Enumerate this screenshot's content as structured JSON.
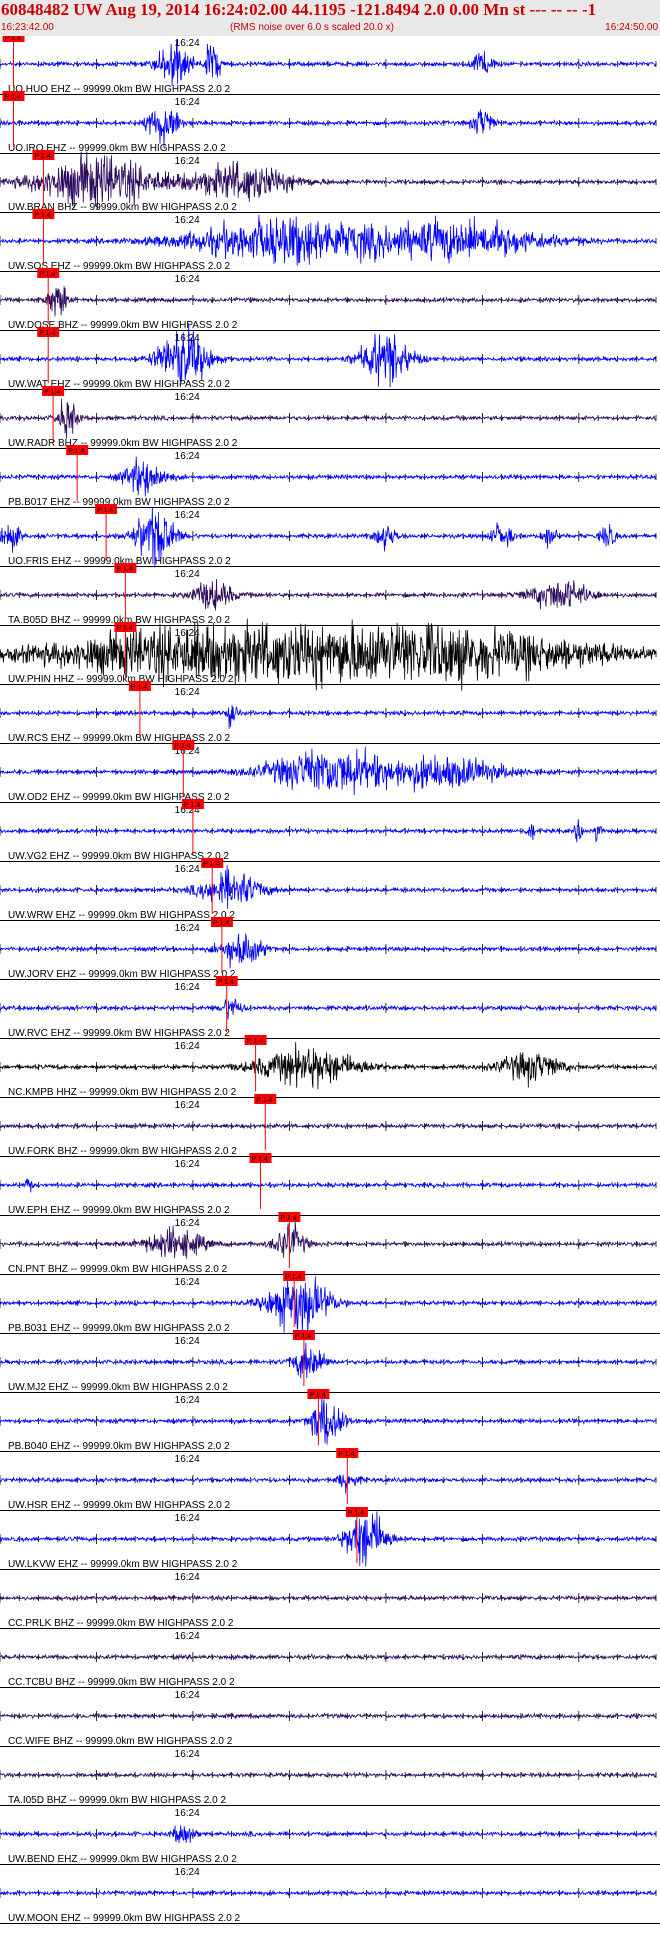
{
  "header": {
    "title": "60848482 UW Aug 19, 2014 16:24:02.00   44.1195 -121.8494  2.0 0.00 Mn st --- -- --   -1",
    "start_time": "16:23:42.00",
    "noise_note": "(RMS noise over 6.0 s scaled 20.0 x)",
    "end_time": "16:24:50.00"
  },
  "chart_data": {
    "type": "line",
    "xlim": [
      "16:23:42.00",
      "16:24:50.00"
    ],
    "minute_mark": "16:24",
    "phase_label": "P 1.4",
    "colors": {
      "blue": "#0000ff",
      "black": "#000000",
      "purple": "#2a0a5e",
      "pick": "#ff0000"
    },
    "series": [
      {
        "name": "UO.HUO EHZ -- 99999.0km BW  HIGHPASS  2.0  2",
        "color": "blue",
        "pick_s": 1.4,
        "events": [
          [
            18,
            3.5,
            1.5
          ],
          [
            22,
            3,
            0.8
          ],
          [
            50,
            2,
            1
          ]
        ],
        "bursts": [
          [
            80,
            1,
            0.8
          ],
          [
            95,
            1.5,
            1
          ]
        ]
      },
      {
        "name": "UO.IRO EHZ -- 99999.0km BW  HIGHPASS  2.0  2",
        "color": "blue",
        "pick_s": 1.4,
        "events": [
          [
            17,
            3,
            1.5
          ],
          [
            50,
            2,
            1
          ]
        ],
        "bursts": []
      },
      {
        "name": "UW.BRAN BHZ -- 99999.0km BW  HIGHPASS  2.0  2",
        "color": "purple",
        "pick_s": 4.5,
        "events": [
          [
            10,
            3.5,
            6
          ],
          [
            25,
            2.5,
            5
          ]
        ],
        "bursts": []
      },
      {
        "name": "UW.SOS EHZ -- 99999.0km BW  HIGHPASS  2.0  2",
        "color": "blue",
        "pick_s": 4.5,
        "events": [
          [
            30,
            3,
            10
          ],
          [
            48,
            2.5,
            8
          ]
        ],
        "bursts": []
      },
      {
        "name": "UW.DOSE BHZ -- 99999.0km BW  HIGHPASS  2.0  2",
        "color": "purple",
        "pick_s": 5.0,
        "events": [
          [
            6,
            2.5,
            1
          ]
        ],
        "bursts": []
      },
      {
        "name": "UW.WAT EHZ -- 99999.0km BW  HIGHPASS  2.0  2",
        "color": "blue",
        "pick_s": 5.0,
        "events": [
          [
            19,
            4,
            2.5
          ],
          [
            40,
            3.5,
            2.5
          ]
        ],
        "bursts": []
      },
      {
        "name": "UW.RADR BHZ -- 99999.0km BW  HIGHPASS  2.0  2",
        "color": "purple",
        "pick_s": 5.5,
        "events": [
          [
            7,
            2.5,
            1
          ]
        ],
        "bursts": []
      },
      {
        "name": "PB.B017 EHZ -- 99999.0km BW  HIGHPASS  2.0  2",
        "color": "blue",
        "pick_s": 8.0,
        "events": [
          [
            15,
            2.5,
            2
          ]
        ],
        "bursts": []
      },
      {
        "name": "UO.FRIS EHZ -- 99999.0km BW  HIGHPASS  2.0  2",
        "color": "blue",
        "pick_s": 11.0,
        "events": [
          [
            16,
            4,
            2
          ],
          [
            1,
            2,
            1
          ]
        ],
        "bursts": [
          [
            40,
            2,
            1.5
          ],
          [
            52,
            2,
            1.5
          ],
          [
            57,
            2,
            1
          ],
          [
            63,
            2,
            1
          ]
        ]
      },
      {
        "name": "TA.B05D BHZ -- 99999.0km BW  HIGHPASS  2.0  2",
        "color": "purple",
        "pick_s": 13.0,
        "events": [
          [
            22,
            2,
            2
          ],
          [
            58,
            2,
            3
          ]
        ],
        "bursts": []
      },
      {
        "name": "UW.PHIN HHZ -- 99999.0km BW  HIGHPASS  2.0  2",
        "color": "black",
        "pick_s": 13.0,
        "events": [
          [
            43,
            4,
            18
          ],
          [
            18,
            3,
            14
          ]
        ],
        "bursts": []
      },
      {
        "name": "UW.RCS EHZ -- 99999.0km BW  HIGHPASS  2.0  2",
        "color": "blue",
        "pick_s": 14.5,
        "events": [
          [
            24,
            2.5,
            0.5
          ]
        ],
        "bursts": []
      },
      {
        "name": "UW.OD2 EHZ -- 99999.0km BW  HIGHPASS  2.0  2",
        "color": "blue",
        "pick_s": 19.0,
        "events": [
          [
            34,
            3,
            6
          ],
          [
            46,
            2,
            6
          ]
        ],
        "bursts": []
      },
      {
        "name": "UW.VG2 EHZ -- 99999.0km BW  HIGHPASS  2.0  2",
        "color": "blue",
        "pick_s": 20.0,
        "events": [],
        "bursts": [
          [
            55,
            2,
            0.5
          ],
          [
            60,
            2,
            0.5
          ],
          [
            62,
            2,
            0.5
          ]
        ]
      },
      {
        "name": "UW.WRW EHZ -- 99999.0km BW  HIGHPASS  2.0  2",
        "color": "blue",
        "pick_s": 22.0,
        "events": [
          [
            24,
            2.5,
            3
          ]
        ],
        "bursts": []
      },
      {
        "name": "UW.JORV EHZ -- 99999.0km BW  HIGHPASS  2.0  2",
        "color": "blue",
        "pick_s": 23.0,
        "events": [
          [
            25,
            2.5,
            2
          ]
        ],
        "bursts": []
      },
      {
        "name": "UW.RVC EHZ -- 99999.0km BW  HIGHPASS  2.0  2",
        "color": "blue",
        "pick_s": 23.5,
        "events": [
          [
            24,
            1.5,
            1
          ]
        ],
        "bursts": []
      },
      {
        "name": "NC.KMPB HHZ -- 99999.0km BW  HIGHPASS  2.0  2",
        "color": "black",
        "pick_s": 26.5,
        "events": [
          [
            32,
            2.5,
            5
          ],
          [
            55,
            2,
            3
          ]
        ],
        "bursts": []
      },
      {
        "name": "UW.FORK BHZ -- 99999.0km BW  HIGHPASS  2.0  2",
        "color": "purple",
        "pick_s": 27.5,
        "events": [],
        "bursts": []
      },
      {
        "name": "UW.EPH EHZ -- 99999.0km BW  HIGHPASS  2.0  2",
        "color": "blue",
        "pick_s": 27.0,
        "events": [
          [
            3,
            1.5,
            0.3
          ]
        ],
        "bursts": []
      },
      {
        "name": "CN.PNT BHZ -- 99999.0km BW  HIGHPASS  2.0  2",
        "color": "purple",
        "pick_s": 30.0,
        "events": [
          [
            30,
            2.5,
            1.5
          ],
          [
            18,
            2,
            3
          ]
        ],
        "bursts": []
      },
      {
        "name": "PB.B031 EHZ -- 99999.0km BW  HIGHPASS  2.0  2",
        "color": "blue",
        "pick_s": 30.5,
        "events": [
          [
            31,
            4,
            3
          ]
        ],
        "bursts": []
      },
      {
        "name": "UW.MJ2 EHZ -- 99999.0km BW  HIGHPASS  2.0  2",
        "color": "blue",
        "pick_s": 31.5,
        "events": [
          [
            32,
            2.5,
            1.5
          ]
        ],
        "bursts": []
      },
      {
        "name": "PB.B040 EHZ -- 99999.0km BW  HIGHPASS  2.0  2",
        "color": "blue",
        "pick_s": 33.0,
        "events": [
          [
            34,
            4,
            1.5
          ]
        ],
        "bursts": []
      },
      {
        "name": "UW.HSR EHZ -- 99999.0km BW  HIGHPASS  2.0  2",
        "color": "blue",
        "pick_s": 36.0,
        "events": [
          [
            36,
            1.5,
            1
          ]
        ],
        "bursts": []
      },
      {
        "name": "UW.LKVW EHZ -- 99999.0km BW  HIGHPASS  2.0  2",
        "color": "blue",
        "pick_s": 37.0,
        "events": [
          [
            38,
            4,
            2
          ]
        ],
        "bursts": []
      },
      {
        "name": "CC.PRLK BHZ -- 99999.0km BW  HIGHPASS  2.0  2",
        "color": "purple",
        "pick_s": null,
        "events": [],
        "bursts": []
      },
      {
        "name": "CC.TCBU BHZ -- 99999.0km BW  HIGHPASS  2.0  2",
        "color": "purple",
        "pick_s": null,
        "events": [],
        "bursts": []
      },
      {
        "name": "CC.WIFE BHZ -- 99999.0km BW  HIGHPASS  2.0  2",
        "color": "purple",
        "pick_s": null,
        "events": [],
        "bursts": []
      },
      {
        "name": "TA.I05D BHZ -- 99999.0km BW  HIGHPASS  2.0  2",
        "color": "purple",
        "pick_s": null,
        "events": [],
        "bursts": []
      },
      {
        "name": "UW.BEND EHZ -- 99999.0km BW  HIGHPASS  2.0  2",
        "color": "blue",
        "pick_s": null,
        "events": [
          [
            19,
            1.5,
            1
          ]
        ],
        "bursts": []
      },
      {
        "name": "UW.MOON EHZ -- 99999.0km BW  HIGHPASS  2.0  2",
        "color": "blue",
        "pick_s": null,
        "events": [],
        "bursts": []
      }
    ]
  }
}
